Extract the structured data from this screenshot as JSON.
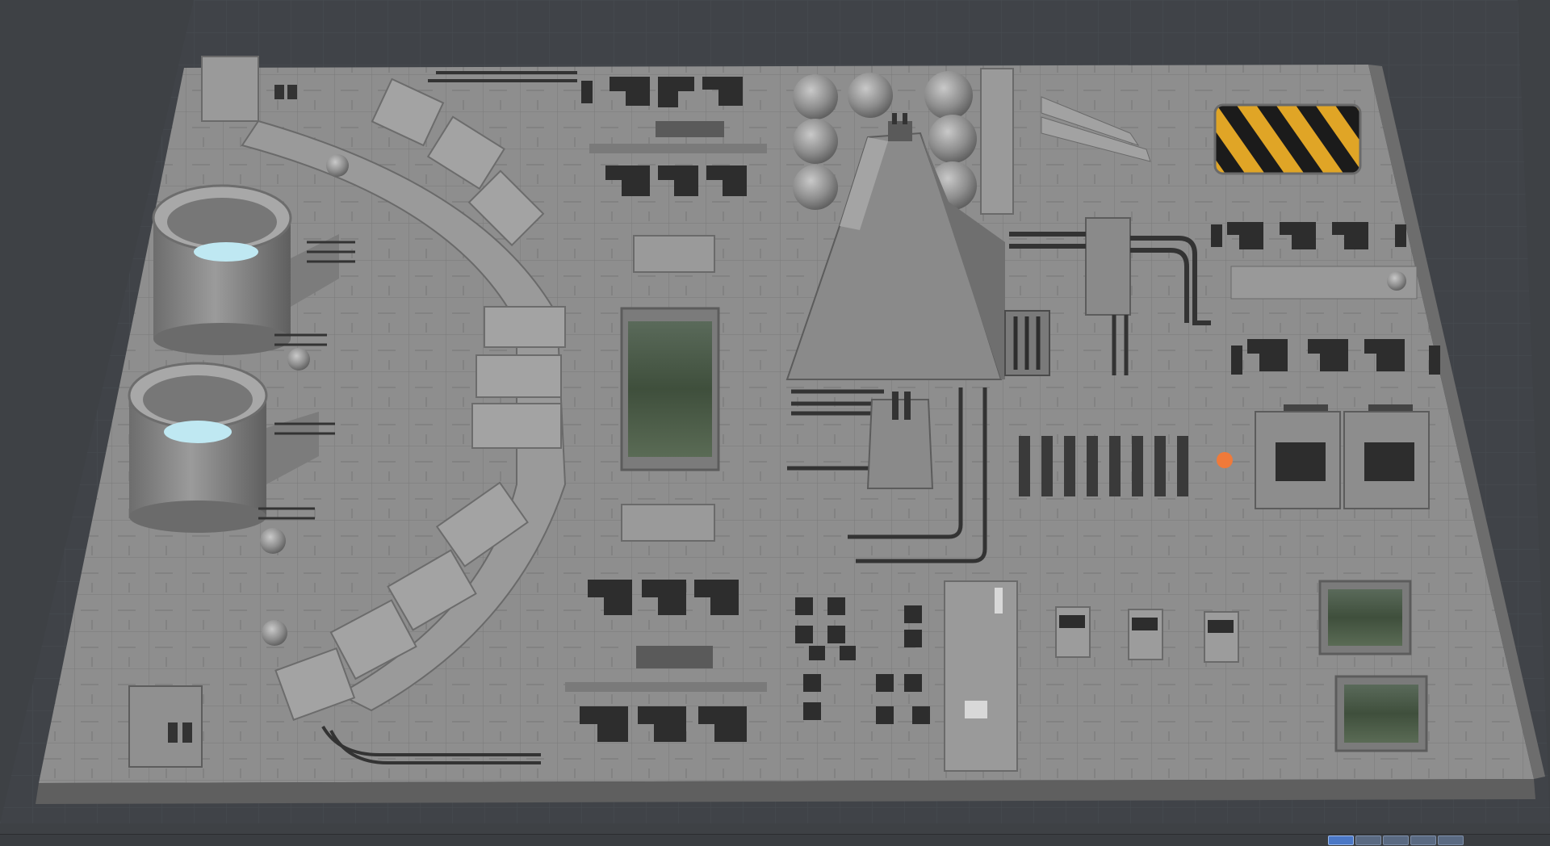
{
  "app": {
    "view": "perspective",
    "background_color": "#3e4145",
    "grid_color": "#4b4f55"
  },
  "scene": {
    "object": "sci-fi-greeble-panel",
    "base_color": "#8e8e8e",
    "hazard_colors": [
      "#1b1b1b",
      "#e0a526"
    ],
    "glass_color": "#bfe8f2",
    "indicator_color": "#f07a3a"
  },
  "viewport_buttons": [
    {
      "name": "view-button-1",
      "active": true
    },
    {
      "name": "view-button-2",
      "active": false
    },
    {
      "name": "view-button-3",
      "active": false
    },
    {
      "name": "view-button-4",
      "active": false
    },
    {
      "name": "view-button-5",
      "active": false
    }
  ]
}
